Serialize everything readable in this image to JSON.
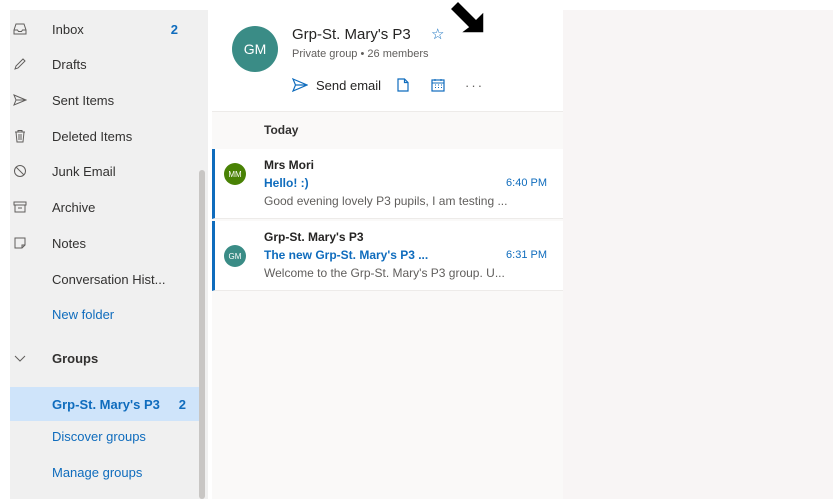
{
  "sidebar": {
    "items": [
      {
        "label": "Inbox",
        "count": "2",
        "icon": "inbox-icon"
      },
      {
        "label": "Drafts",
        "icon": "pencil-icon"
      },
      {
        "label": "Sent Items",
        "icon": "send-icon"
      },
      {
        "label": "Deleted Items",
        "icon": "trash-icon"
      },
      {
        "label": "Junk Email",
        "icon": "blocked-icon"
      },
      {
        "label": "Archive",
        "icon": "archive-icon"
      },
      {
        "label": "Notes",
        "icon": "note-icon"
      },
      {
        "label": "Conversation Hist..."
      },
      {
        "label": "New folder"
      }
    ],
    "groups_label": "Groups",
    "groups": [
      {
        "label": "Grp-St. Mary's P3",
        "count": "2"
      },
      {
        "label": "Discover groups"
      },
      {
        "label": "Manage groups"
      }
    ]
  },
  "group_header": {
    "avatar_initials": "GM",
    "name": "Grp-St. Mary's P3",
    "star": "☆",
    "privacy": "Private group",
    "members": "26 members",
    "send_email": "Send email",
    "more": "···"
  },
  "message_list": {
    "section": "Today",
    "messages": [
      {
        "initials": "MM",
        "avatar_color": "#498205",
        "sender": "Mrs Mori",
        "subject": "Hello! :)",
        "time": "6:40 PM",
        "preview": "Good evening lovely P3 pupils, I am testing ..."
      },
      {
        "initials": "GM",
        "avatar_color": "#3a8c86",
        "sender": "Grp-St. Mary's P3",
        "subject": "The new Grp-St. Mary's P3 ...",
        "time": "6:31 PM",
        "preview": "Welcome to the Grp-St. Mary's P3 group. U..."
      }
    ]
  },
  "colors": {
    "accent": "#0f6cbd",
    "sidebar_bg": "#f0f0f0",
    "selected_bg": "#cfe4fa"
  }
}
